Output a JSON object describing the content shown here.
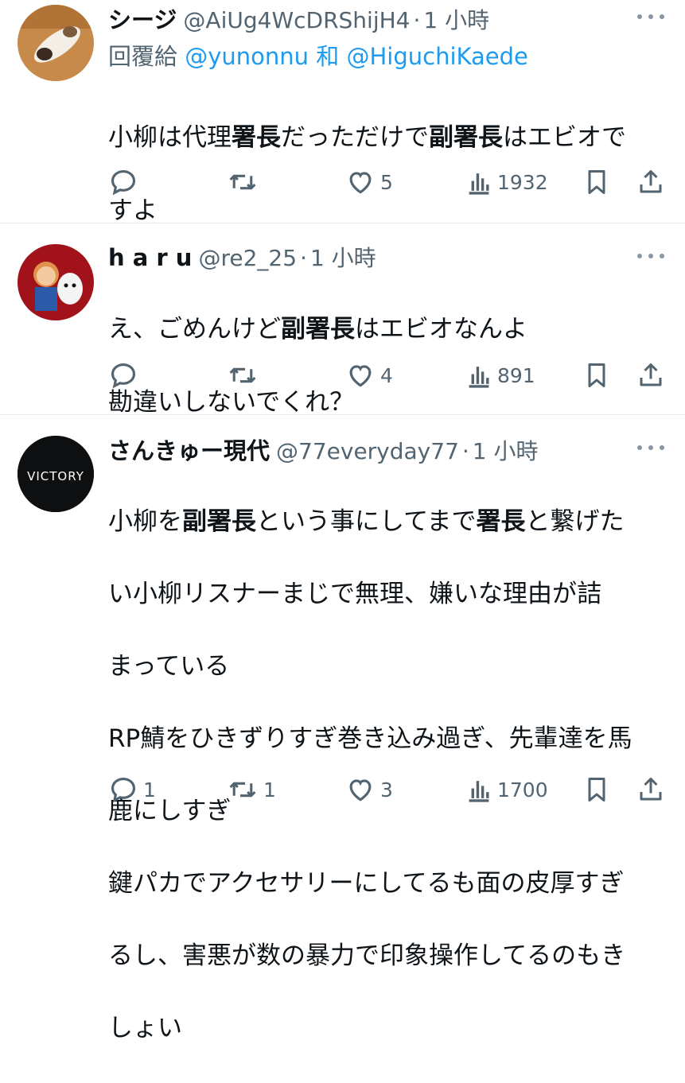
{
  "tweets": [
    {
      "display_name": "シージ",
      "handle": "@AiUg4WcDRShijH4",
      "time": "1 小時",
      "reply_label": "回覆給",
      "reply_mention_1": "@yunonnu",
      "reply_and": "和",
      "reply_mention_2": "@HiguchiKaede",
      "text": "小柳は代理署長だっただけで副署長はエビオです\nすよ",
      "text_line1": "小柳は代理署長だっただけで副署長はエビオで",
      "text_line2": "すよ",
      "replies": "",
      "retweets": "",
      "likes": "5",
      "views": "1932"
    },
    {
      "display_name": "h a r u",
      "handle": "@re2_25",
      "time": "1 小時",
      "text_line1": "え、ごめんけど副署長はエビオなんよ",
      "text_line2": "勘違いしないでくれ？",
      "replies": "",
      "retweets": "",
      "likes": "4",
      "views": "891"
    },
    {
      "display_name": "さんきゅー現代",
      "handle": "@77everyday77",
      "time": "1 小時",
      "avatar_text": "VICTORY",
      "lines": [
        "小柳を副署長という事にしてまで署長と繋げた",
        "い小柳リスナーまじで無理、嫌いな理由が詰",
        "まっている",
        "RP鯖をひきずりすぎ巻き込み過ぎ、先輩達を馬",
        "鹿にしすぎ",
        "鍵パカでアクセサリーにしてるも面の皮厚すぎ",
        "るし、害悪が数の暴力で印象操作してるのもき",
        "しょい"
      ],
      "replies": "1",
      "retweets": "1",
      "likes": "3",
      "views": "1700"
    }
  ],
  "dot_separator": "·",
  "colors": {
    "text": "#0f1419",
    "secondary": "#536471",
    "link": "#1d9bf0",
    "divider": "#e6e9ec"
  },
  "icons": [
    "reply-icon",
    "retweet-icon",
    "like-icon",
    "views-icon",
    "bookmark-icon",
    "share-icon",
    "more-icon"
  ]
}
